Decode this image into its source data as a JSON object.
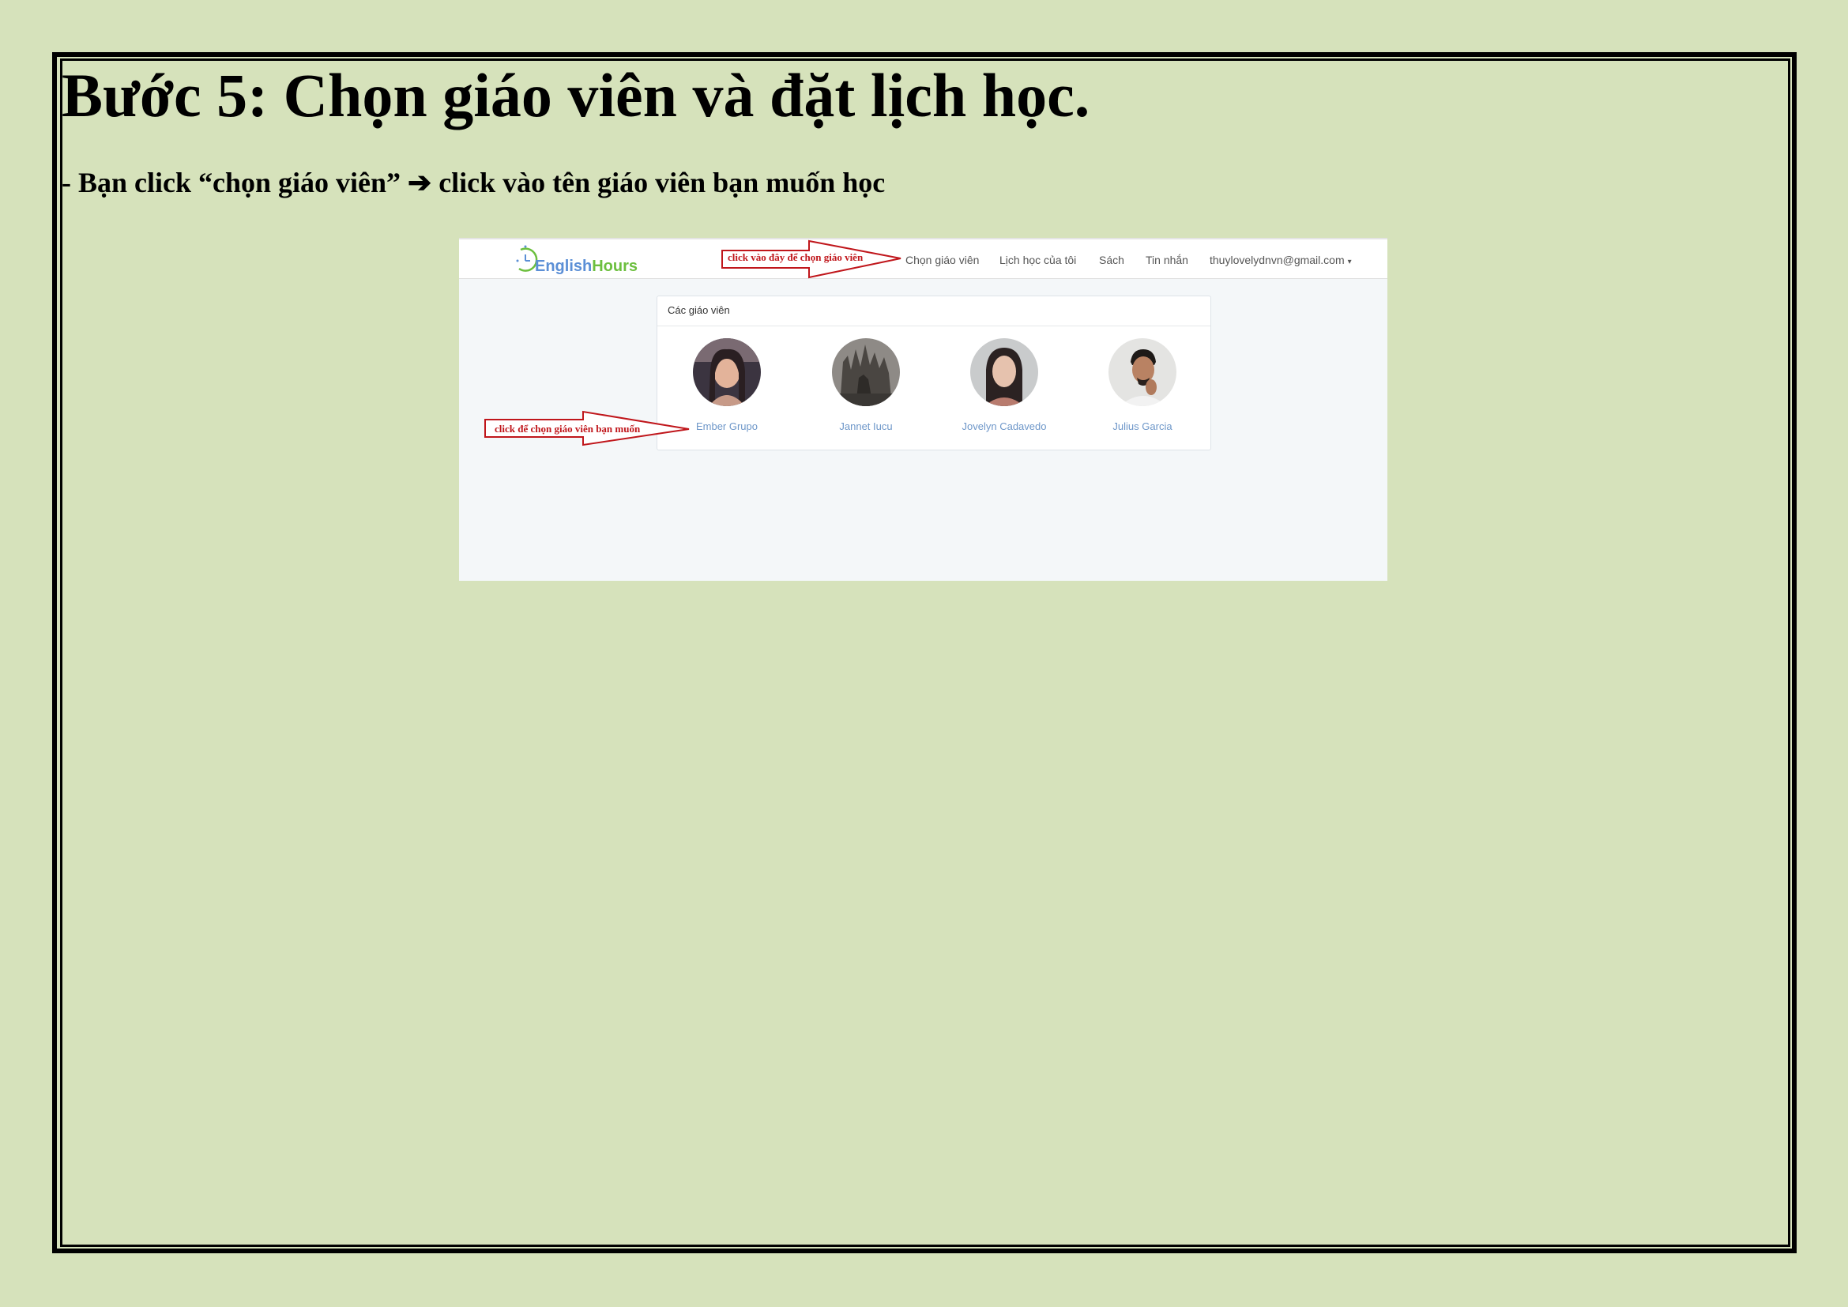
{
  "document": {
    "heading": "Bước 5: Chọn giáo viên và đặt lịch học.",
    "instruction": "- Bạn click “chọn giáo viên” ➔ click vào tên giáo viên bạn muốn học"
  },
  "screenshot": {
    "logo": {
      "english": "English",
      "hours": "Hours"
    },
    "nav": {
      "items": [
        "Chọn giáo viên",
        "Lịch học của tôi",
        "Sách",
        "Tin nhắn"
      ],
      "account": "thuylovelydnvn@gmail.com"
    },
    "panel": {
      "title": "Các giáo viên",
      "teachers": [
        {
          "name": "Ember Grupo"
        },
        {
          "name": "Jannet Iucu"
        },
        {
          "name": "Jovelyn Cadavedo"
        },
        {
          "name": "Julius Garcia"
        }
      ]
    },
    "callouts": {
      "nav_hint": "click vào đây để chọn giáo viên",
      "teacher_hint": "click để chọn giáo viên bạn muốn"
    },
    "colors": {
      "page_background": "#d6e2bb",
      "callout_red": "#c0161b",
      "link_blue": "#6e97c9",
      "logo_blue": "#5b8fd6",
      "logo_green": "#6cbf3e"
    }
  }
}
